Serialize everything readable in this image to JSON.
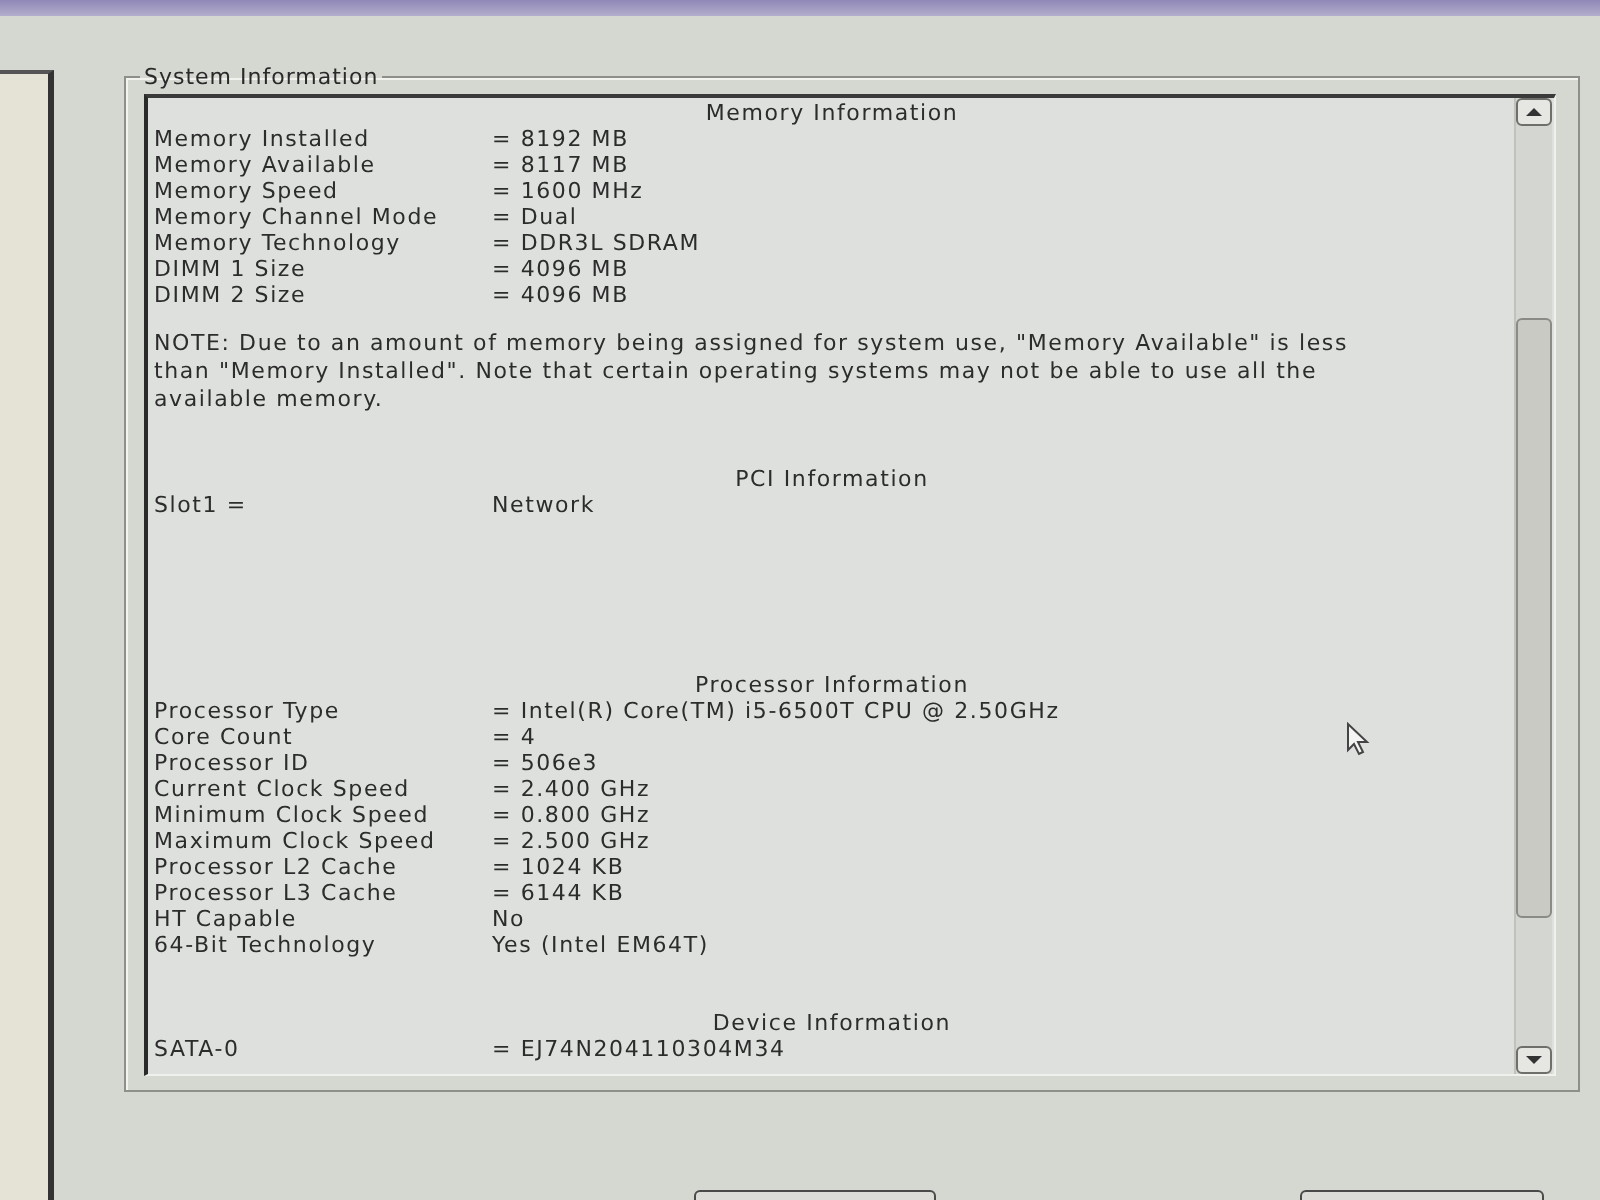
{
  "group_box": {
    "title": "System Information"
  },
  "sections": [
    {
      "heading": "Memory Information",
      "rows": [
        {
          "label": "Memory Installed",
          "value": "= 8192 MB"
        },
        {
          "label": "Memory Available",
          "value": "= 8117 MB"
        },
        {
          "label": "Memory Speed",
          "value": "= 1600 MHz"
        },
        {
          "label": "Memory Channel Mode",
          "value": "= Dual"
        },
        {
          "label": "Memory Technology",
          "value": "= DDR3L SDRAM"
        },
        {
          "label": "DIMM 1 Size",
          "value": "= 4096 MB"
        },
        {
          "label": "DIMM 2 Size",
          "value": "= 4096 MB"
        }
      ],
      "note": "NOTE: Due to an amount of memory being assigned for system use, \"Memory Available\" is less than \"Memory Installed\". Note that certain operating systems may not be able to use all the available memory."
    },
    {
      "heading": "PCI Information",
      "rows": [
        {
          "label": "Slot1 =",
          "value": "Network"
        }
      ]
    },
    {
      "heading": "Processor Information",
      "rows": [
        {
          "label": "Processor Type",
          "value": "= Intel(R) Core(TM) i5-6500T CPU @ 2.50GHz"
        },
        {
          "label": "Core Count",
          "value": "= 4"
        },
        {
          "label": "Processor ID",
          "value": "= 506e3"
        },
        {
          "label": "Current Clock Speed",
          "value": "= 2.400 GHz"
        },
        {
          "label": "Minimum Clock Speed",
          "value": "= 0.800 GHz"
        },
        {
          "label": "Maximum Clock Speed",
          "value": "= 2.500 GHz"
        },
        {
          "label": "Processor L2 Cache",
          "value": "= 1024 KB"
        },
        {
          "label": "Processor L3 Cache",
          "value": "= 6144 KB"
        },
        {
          "label": "HT Capable",
          "value": "No"
        },
        {
          "label": "64-Bit Technology",
          "value": "Yes (Intel EM64T)"
        }
      ]
    },
    {
      "heading": "Device Information",
      "rows": [
        {
          "label": "SATA-0",
          "value": "= EJ74N204110304M34"
        }
      ]
    }
  ]
}
